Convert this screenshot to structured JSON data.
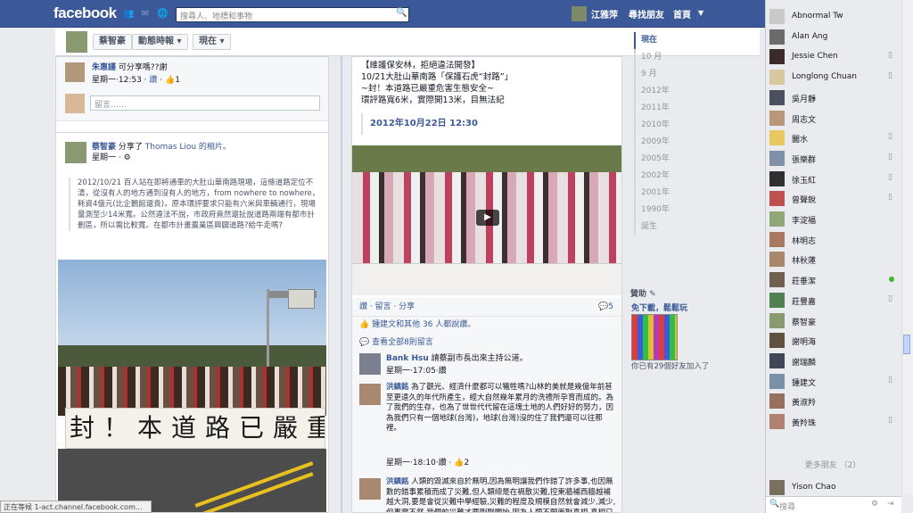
{
  "topbar": {
    "logo": "facebook",
    "search_placeholder": "搜尋人、地標和事物",
    "user_name": "江雅萍",
    "find_friends": "尋找朋友",
    "home": "首頁"
  },
  "timeline_bar": {
    "name": "蔡智豪",
    "feed_button": "動態時報",
    "now_button": "現在"
  },
  "left_col": {
    "comment1": {
      "author": "朱惠謹",
      "text": "可分享嗎??謝",
      "meta": "星期一·12:53",
      "like": "讚",
      "likes": "1"
    },
    "comment_placeholder": "留言……",
    "share_post": {
      "author": "蔡智豪",
      "shared": "分享了",
      "source": "Thomas Liou 的相片。",
      "time": "星期一",
      "body": "2012/10/21 百人站在即將通車的大肚山華南路現場，這條道路定位不清，從沒有人的地方通到沒有人的地方，from nowhere to nowhere，耗資4億元(比企鵝館還貴)，原本環評要求只能有六米與車輛通行，現場量測至少14米寬。公然違法不說，市政府竟然還扯說道路兩端有都市計劃區，所以需比較寬。在都市計畫農業區興闢道路?給牛走嗎?"
    },
    "banner_text": "封！本道路已嚴重危"
  },
  "center_col": {
    "post_title": "【維護保安林，拒絕違法開發】",
    "post_line2": "10/21大肚山華南路「保護石虎“封路”」",
    "post_line3": "~封！本道路已嚴重危害生態安全~",
    "post_line4": "環評路寬6米，實際開13米，目無法紀",
    "date": "2012年10月22日 12:30",
    "actions": "讚 · 留言 · 分享",
    "comment_count": "5",
    "likes_line": "鍾建文和其他 36 人都說讚。",
    "view_all": "查看全部8則留言",
    "comments": [
      {
        "author": "Bank Hsu",
        "text": "請蔡副市長出來主持公道。",
        "meta": "星期一·17:05·讚"
      },
      {
        "author": "洪鎮銘",
        "text": "為了觀光、經濟什麼都可以犧牲嗎?山林的美就是幾億年前甚至更遠久的年代所產生，經大自然幾年累月的洗禮所孕育而成的。為了我們的生存，也為了世世代代留在這塊土地的人們好好的努力，因為我們只有一個地球(台灣)，地球(台灣)沒的住了我們還可以往那裡。",
        "meta": "星期一·18:10·讚",
        "likes": "2"
      },
      {
        "author": "洪鎮銘",
        "text": "人類的毀滅來自於無明,因為無明讓我們作錯了許多事,也因無數的錯事累積而成了災難,但人類總是在禍散災難,控東牆補西牆越補越大洞,要是會從災難中學經驗,災難的程度及規模自然就會減少,減少,但事實不然,我們的災難才要剛剛開始,因為人類不願面對真相,真相只會一直惡性循環,會一直讓人類吃盡為止,不改善就毀滅了,當人類遇到災難時會求神拜佛,天下太平時就"
      }
    ]
  },
  "right_nav": {
    "items": [
      "現在",
      "10 月",
      "9 月",
      "2012年",
      "2011年",
      "2010年",
      "2009年",
      "2005年",
      "2002年",
      "2001年",
      "1990年",
      "誕生"
    ],
    "sponsored": "贊助",
    "ad_title": "免下載，鬆鬆玩",
    "ad_text": "你已有29個好友加入了"
  },
  "chat": {
    "friends": [
      {
        "name": "Abnormal Tw",
        "color": "#c9c9c9",
        "status": "none"
      },
      {
        "name": "Alan Ang",
        "color": "#6b6b6b",
        "status": "none"
      },
      {
        "name": "Jessie Chen",
        "color": "#3a2a2a",
        "status": "mobile"
      },
      {
        "name": "Longlong Chuan",
        "color": "#d8c8a0",
        "status": "mobile"
      },
      {
        "name": "吳月靜",
        "color": "#4a5060",
        "status": "none"
      },
      {
        "name": "周志文",
        "color": "#b89878",
        "status": "none"
      },
      {
        "name": "闔水",
        "color": "#e8c860",
        "status": "mobile"
      },
      {
        "name": "張樂群",
        "color": "#8090a8",
        "status": "mobile"
      },
      {
        "name": "徐玉紅",
        "color": "#303030",
        "status": "mobile"
      },
      {
        "name": "曾聲銳",
        "color": "#c05050",
        "status": "mobile"
      },
      {
        "name": "李淀福",
        "color": "#90a878",
        "status": "none"
      },
      {
        "name": "林明志",
        "color": "#a87860",
        "status": "none"
      },
      {
        "name": "林秋蓮",
        "color": "#a88868",
        "status": "none"
      },
      {
        "name": "莊垂潔",
        "color": "#706050",
        "status": "online"
      },
      {
        "name": "莊豐嘉",
        "color": "#508050",
        "status": "mobile"
      },
      {
        "name": "蔡智豪",
        "color": "#8a9a70",
        "status": "none"
      },
      {
        "name": "謝明海",
        "color": "#605040",
        "status": "none"
      },
      {
        "name": "謝瑞麟",
        "color": "#404858",
        "status": "none"
      },
      {
        "name": "鍾建文",
        "color": "#7890a8",
        "status": "mobile"
      },
      {
        "name": "黃淑羚",
        "color": "#987060",
        "status": "none"
      },
      {
        "name": "黃羚珠",
        "color": "#b08070",
        "status": "mobile"
      }
    ],
    "more_friends": "更多朋友 （2）",
    "extra_friend": "Yison Chao",
    "search_placeholder": "搜尋"
  },
  "status_bar": "正在等候 1-act.channel.facebook.com..."
}
